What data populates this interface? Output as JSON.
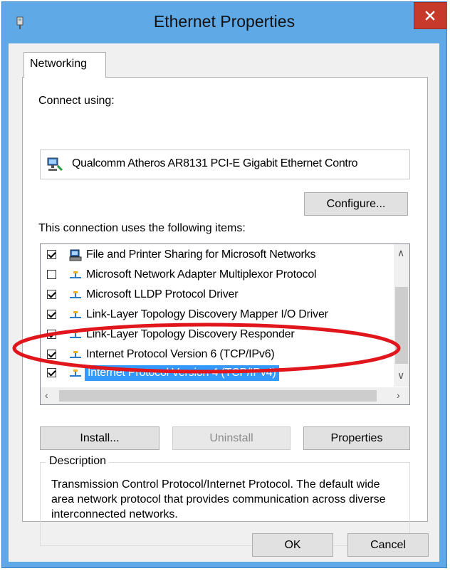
{
  "window": {
    "title": "Ethernet Properties",
    "close_label": "×"
  },
  "tabs": [
    {
      "label": "Networking"
    }
  ],
  "networking": {
    "connect_using_label": "Connect using:",
    "adapter_name": "Qualcomm Atheros AR8131 PCI-E Gigabit Ethernet Contro",
    "configure_label": "Configure...",
    "items_label": "This connection uses the following items:",
    "items": [
      {
        "label": "File and Printer Sharing for Microsoft Networks",
        "checked": true,
        "icon": "printer-share-icon"
      },
      {
        "label": "Microsoft Network Adapter Multiplexor Protocol",
        "checked": false,
        "icon": "network-protocol-icon"
      },
      {
        "label": "Microsoft LLDP Protocol Driver",
        "checked": true,
        "icon": "network-protocol-icon"
      },
      {
        "label": "Link-Layer Topology Discovery Mapper I/O Driver",
        "checked": true,
        "icon": "network-protocol-icon"
      },
      {
        "label": "Link-Layer Topology Discovery Responder",
        "checked": true,
        "icon": "network-protocol-icon"
      },
      {
        "label": "Internet Protocol Version 6 (TCP/IPv6)",
        "checked": true,
        "icon": "network-protocol-icon"
      },
      {
        "label": "Internet Protocol Version 4 (TCP/IPv4)",
        "checked": true,
        "icon": "network-protocol-icon",
        "selected": true
      }
    ],
    "install_label": "Install...",
    "uninstall_label": "Uninstall",
    "properties_label": "Properties",
    "description_title": "Description",
    "description_text": "Transmission Control Protocol/Internet Protocol. The default wide area network protocol that provides communication across diverse interconnected networks."
  },
  "footer": {
    "ok_label": "OK",
    "cancel_label": "Cancel"
  },
  "colors": {
    "title_bar": "#5fa9e6",
    "close_button": "#c7392b",
    "selection": "#3399ff",
    "annotation_ellipse": "#e0161c"
  }
}
